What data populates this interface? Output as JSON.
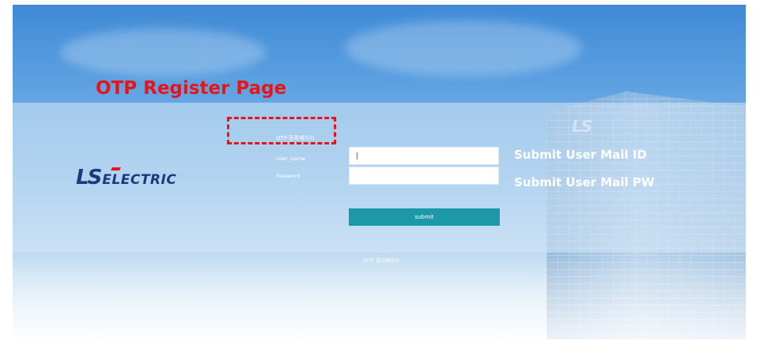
{
  "annotations": {
    "title": "OTP Register Page",
    "user_id_note": "Submit User Mail ID",
    "user_pw_note": "Submit User Mail PW"
  },
  "logo": {
    "mark": "LS",
    "text": "ELECTRIC",
    "building_sign": "LS"
  },
  "login_form": {
    "page_label": "OTP 등록페이지",
    "username_label": "User_name",
    "username_value": "|",
    "password_label": "Password",
    "password_value": "",
    "submit_label": "submit"
  },
  "footer": {
    "manage_link": "OTP 관리페이지"
  },
  "colors": {
    "annotation_red": "#e8141a",
    "submit_teal": "#1c98a8",
    "logo_navy": "#1b3a7a"
  }
}
